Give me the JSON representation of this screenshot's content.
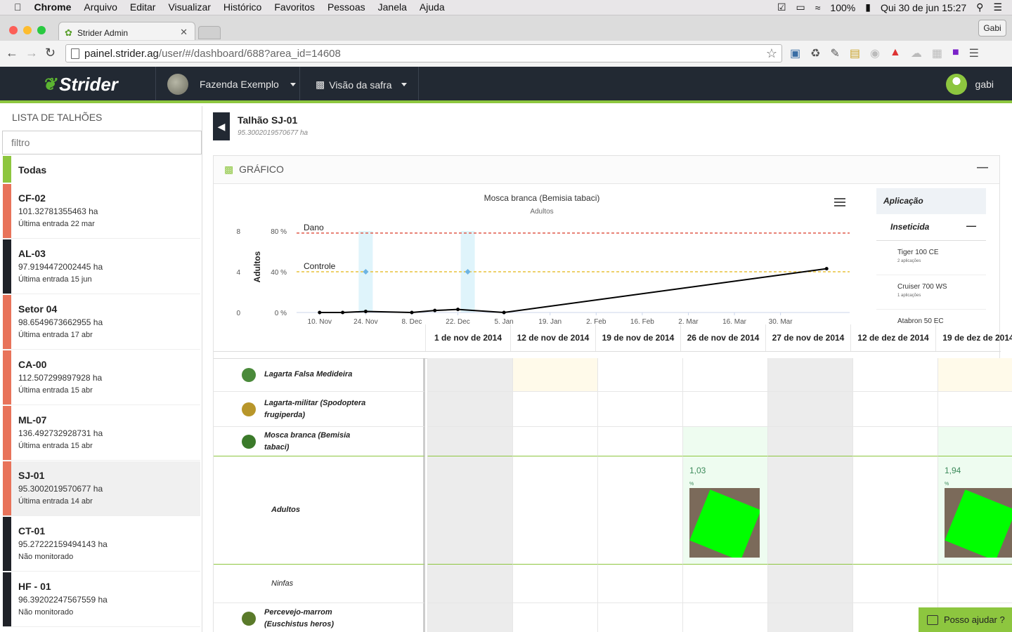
{
  "menubar": {
    "app": "Chrome",
    "items": [
      "Arquivo",
      "Editar",
      "Visualizar",
      "Histórico",
      "Favoritos",
      "Pessoas",
      "Janela",
      "Ajuda"
    ],
    "battery": "100%",
    "datetime": "Qui 30 de jun  15:27"
  },
  "browser": {
    "tab_title": "Strider Admin",
    "profile": "Gabi",
    "url_host": "painel.strider.ag",
    "url_path": "/user/#/dashboard/688?area_id=14608"
  },
  "header": {
    "logo": "Strider",
    "farm": "Fazenda Exemplo",
    "view": "Visão da safra",
    "user": "gabi"
  },
  "sidebar": {
    "title": "LISTA DE TALHÕES",
    "filter_placeholder": "filtro",
    "all_label": "Todas",
    "items": [
      {
        "name": "CF-02",
        "area": "101.32781355463 ha",
        "entry": "Última entrada 22 mar",
        "color": "#e8735a"
      },
      {
        "name": "AL-03",
        "area": "97.9194472002445 ha",
        "entry": "Última entrada 15 jun",
        "color": "#1f2228"
      },
      {
        "name": "Setor 04",
        "area": "98.6549673662955 ha",
        "entry": "Última entrada 17 abr",
        "color": "#e8735a"
      },
      {
        "name": "CA-00",
        "area": "112.507299897928 ha",
        "entry": "Última entrada 15 abr",
        "color": "#e8735a"
      },
      {
        "name": "ML-07",
        "area": "136.492732928731 ha",
        "entry": "Última entrada 15 abr",
        "color": "#e8735a"
      },
      {
        "name": "SJ-01",
        "area": "95.3002019570677 ha",
        "entry": "Última entrada 14 abr",
        "color": "#e8735a"
      },
      {
        "name": "CT-01",
        "area": "95.27222159494143 ha",
        "entry": "Não monitorado",
        "color": "#1f2228"
      },
      {
        "name": "HF - 01",
        "area": "96.39202247567559 ha",
        "entry": "Não monitorado",
        "color": "#1f2228"
      }
    ]
  },
  "plot": {
    "name": "Talhão SJ-01",
    "area": "95.3002019570677 ha"
  },
  "panel": {
    "title": "GRÁFICO"
  },
  "chart_data": {
    "type": "line",
    "title": "Mosca branca (Bemisia tabaci)",
    "subtitle": "Adultos",
    "ylabel": "Adultos",
    "yticks_left": [
      "8",
      "4",
      "0"
    ],
    "yticks_right": [
      "80 %",
      "40 %",
      "0 %"
    ],
    "ylim": [
      0,
      8
    ],
    "xticks": [
      "10. Nov",
      "24. Nov",
      "8. Dec",
      "22. Dec",
      "5. Jan",
      "19. Jan",
      "2. Feb",
      "16. Feb",
      "2. Mar",
      "16. Mar",
      "30. Mar"
    ],
    "xlim_days": [
      -7,
      161
    ],
    "series": [
      {
        "values_x_days": [
          0,
          7,
          14,
          28,
          35,
          42,
          56,
          154
        ],
        "values": [
          0,
          0,
          0.1,
          0,
          0.2,
          0.3,
          0,
          4.3
        ]
      }
    ],
    "thresholds": [
      {
        "name": "Dano",
        "value": 7.8,
        "color": "#e05a4a"
      },
      {
        "name": "Controle",
        "value": 4,
        "color": "#e8c23a"
      }
    ],
    "applications_days": [
      14,
      45
    ],
    "application_values": [
      4,
      4
    ]
  },
  "legend": {
    "header": "Aplicação",
    "group": "Inseticida",
    "items": [
      {
        "name": "Tiger 100 CE",
        "count": "2 aplicações"
      },
      {
        "name": "Cruiser 700 WS",
        "count": "1 aplicações"
      },
      {
        "name": "Atabron 50 EC",
        "count": ""
      }
    ]
  },
  "grid": {
    "dates": [
      "1 de nov de 2014",
      "12 de nov de 2014",
      "19 de nov de 2014",
      "26 de nov de 2014",
      "27 de nov de 2014",
      "12 de dez de 2014",
      "19 de dez de 2014"
    ],
    "rows": [
      {
        "label": "Lagarta Falsa Medideira",
        "icon_color": "#4a8a3a"
      },
      {
        "label": "Lagarta-militar (Spodoptera frugiperda)",
        "icon_color": "#b8962a"
      },
      {
        "label": "Mosca branca (Bemisia tabaci)",
        "icon_color": "#3b7a2a"
      },
      {
        "label": "Adultos",
        "icon_color": ""
      },
      {
        "label": "Ninfas",
        "icon_color": ""
      },
      {
        "label": "Percevejo-marrom (Euschistus heros)",
        "icon_color": "#5a7a2a"
      }
    ],
    "adult_values": [
      {
        "col": 3,
        "value": "1,03",
        "unit": "%"
      },
      {
        "col": 6,
        "value": "1,94",
        "unit": "%"
      }
    ]
  },
  "help": {
    "label": "Posso ajudar ?"
  }
}
